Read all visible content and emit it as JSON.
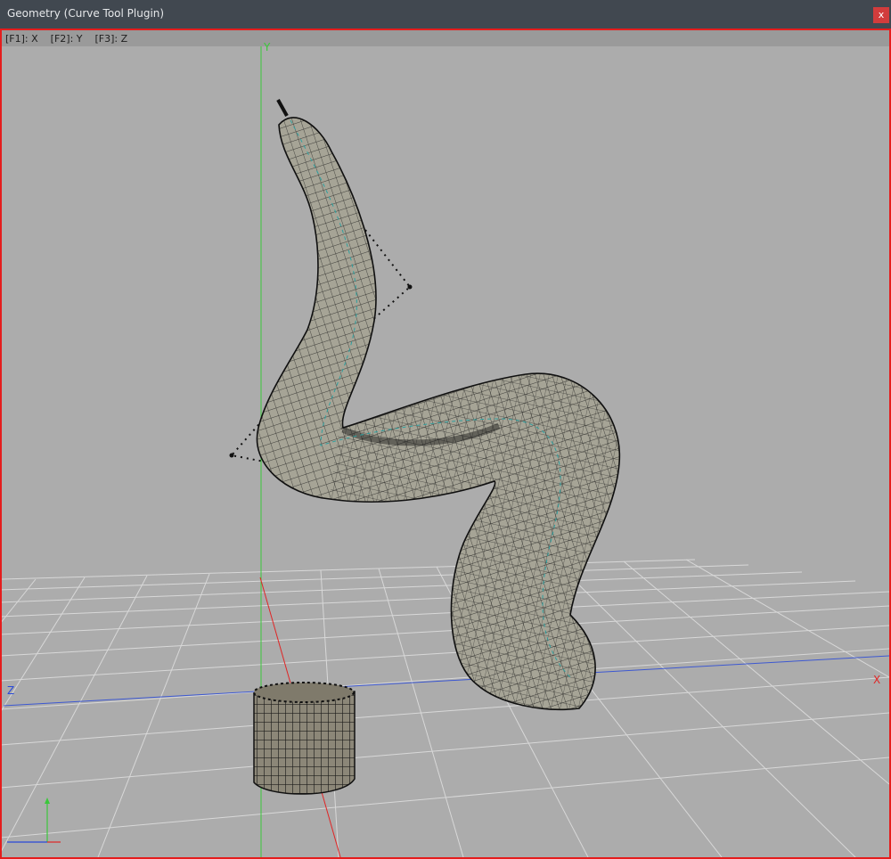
{
  "window": {
    "title": "Geometry (Curve Tool Plugin)",
    "close_label": "x"
  },
  "viewport": {
    "hotkeys": [
      "[F1]: X",
      "[F2]: Y",
      "[F3]: Z"
    ],
    "axis_labels": {
      "x": "X",
      "y": "Y",
      "z": "Z"
    },
    "colors": {
      "background": "#acacac",
      "border": "#e51d1d",
      "grid": "#d9d9d9",
      "axis_x": "#e02525",
      "axis_y": "#3ac83a",
      "axis_z": "#2a4ad8",
      "tube_fill": "#9f9d8f",
      "cylinder_fill": "#8c8778"
    }
  }
}
